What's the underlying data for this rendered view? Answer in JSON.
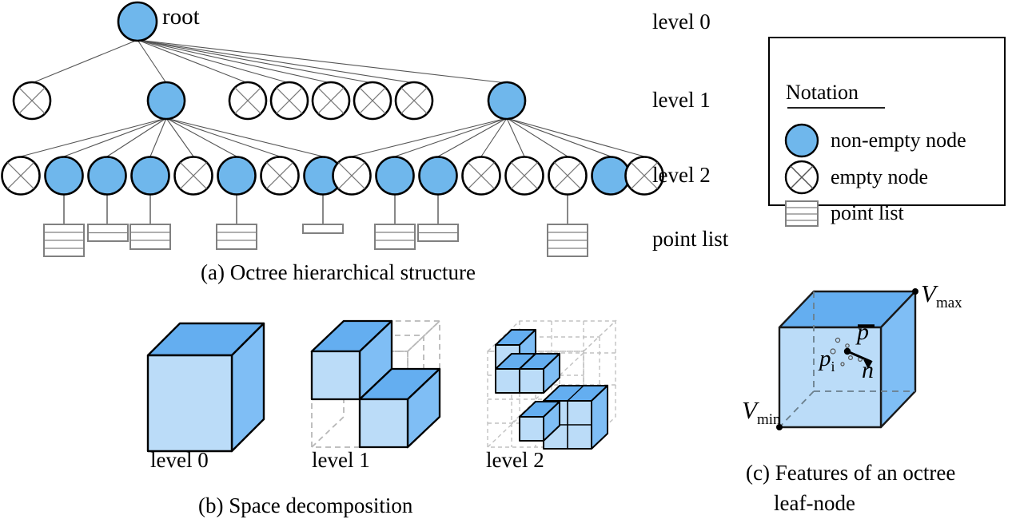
{
  "figure": {
    "panel_a": {
      "caption": "(a) Octree hierarchical structure",
      "root_label": "root",
      "level_labels": [
        "level 0",
        "level 1",
        "level 2"
      ],
      "point_list_label": "point list",
      "level0": {
        "nodes": [
          {
            "type": "non-empty"
          }
        ]
      },
      "level1": {
        "nodes": [
          {
            "type": "empty"
          },
          {
            "type": "non-empty"
          },
          {
            "type": "empty"
          },
          {
            "type": "empty"
          },
          {
            "type": "empty"
          },
          {
            "type": "empty"
          },
          {
            "type": "empty"
          },
          {
            "type": "non-empty"
          }
        ]
      },
      "level2_group1": {
        "nodes": [
          {
            "type": "empty"
          },
          {
            "type": "non-empty"
          },
          {
            "type": "non-empty"
          },
          {
            "type": "non-empty"
          },
          {
            "type": "empty"
          },
          {
            "type": "non-empty"
          },
          {
            "type": "empty"
          },
          {
            "type": "non-empty"
          }
        ]
      },
      "level2_group2": {
        "nodes": [
          {
            "type": "empty"
          },
          {
            "type": "non-empty"
          },
          {
            "type": "non-empty"
          },
          {
            "type": "empty"
          },
          {
            "type": "empty"
          },
          {
            "type": "empty"
          },
          {
            "type": "non-empty"
          },
          {
            "type": "empty"
          }
        ]
      },
      "point_lists": [
        {
          "rows": 4
        },
        {
          "rows": 2
        },
        {
          "rows": 3
        },
        {
          "rows": 3
        },
        {
          "rows": 1
        },
        {
          "rows": 3
        },
        {
          "rows": 2
        },
        {
          "rows": 4
        }
      ]
    },
    "panel_b": {
      "caption": "(b) Space decomposition",
      "cube_labels": [
        "level 0",
        "level 1",
        "level 2"
      ]
    },
    "panel_c": {
      "caption_line1": "(c) Features of an octree",
      "caption_line2": "leaf-node",
      "v_max_label": "V",
      "v_max_sub": "max",
      "v_min_label": "V",
      "v_min_sub": "min",
      "point_label": "p",
      "point_sub": "i",
      "centroid_label": "p",
      "normal_label": "n"
    },
    "notation": {
      "title": "Notation",
      "items": [
        {
          "icon": "filled-circle-icon",
          "label": "non-empty node"
        },
        {
          "icon": "crossed-circle-icon",
          "label": "empty node"
        },
        {
          "icon": "point-list-icon",
          "label": "point list"
        }
      ]
    },
    "colors": {
      "node_blue": "#6FB7EC",
      "cube_top": "#64AEF0",
      "cube_front": "#BBDCF8",
      "cube_right": "#7FBEF5",
      "outline": "#000000",
      "dashed_gray": "#B8B8B8",
      "list_gray": "#808080"
    }
  }
}
